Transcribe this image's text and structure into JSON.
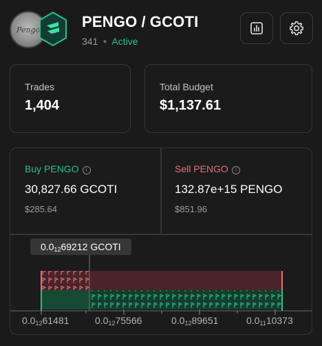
{
  "header": {
    "base_token": "PENGO",
    "quote_token": "GCOTI",
    "separator": "/",
    "base_logo_text": "Pengo",
    "bot_id": "341",
    "status": "Active"
  },
  "icons": {
    "chart": "bar-chart-icon",
    "settings": "gear-icon",
    "info": "info-icon"
  },
  "stats": {
    "trades_label": "Trades",
    "trades_value": "1,404",
    "budget_label": "Total Budget",
    "budget_value": "$1,137.61"
  },
  "buy": {
    "title": "Buy PENGO",
    "amount": "30,827.66 GCOTI",
    "usd": "$285.64"
  },
  "sell": {
    "title": "Sell PENGO",
    "amount": "132.87e+15 PENGO",
    "usd": "$851.96"
  },
  "chart_data": {
    "type": "area",
    "current_price": {
      "prefix": "0.0",
      "zeros": "12",
      "digits": "69212",
      "unit": "GCOTI"
    },
    "x_ticks": [
      {
        "prefix": "0.0",
        "zeros": "12",
        "digits": "61481"
      },
      {
        "prefix": "0.0",
        "zeros": "12",
        "digits": "75566"
      },
      {
        "prefix": "0.0",
        "zeros": "12",
        "digits": "89651"
      },
      {
        "prefix": "0.0",
        "zeros": "11",
        "digits": "10373"
      }
    ],
    "buy_range": [
      "0.0₁₂61481",
      "0.0₁₂69212"
    ],
    "sell_range": [
      "0.0₁₂69212",
      "0.0₁₁10373"
    ],
    "colors": {
      "buy": "#2bc08a",
      "sell": "#e0737a",
      "buy_fill": "#143d2d",
      "sell_fill": "#4a2428"
    }
  }
}
